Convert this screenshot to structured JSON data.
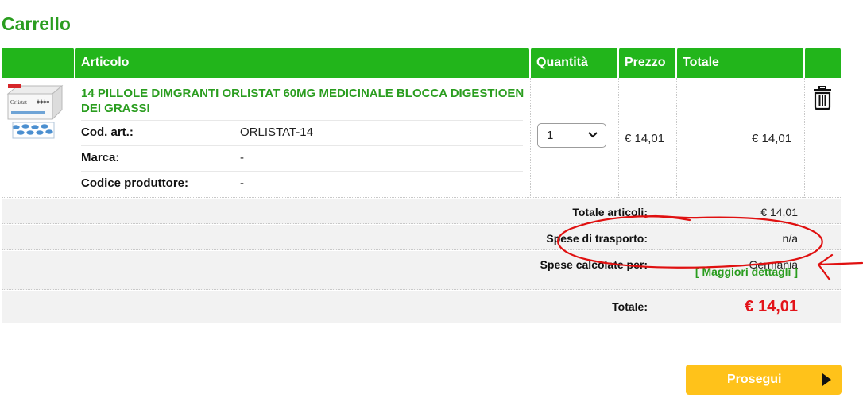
{
  "page": {
    "title": "Carrello"
  },
  "table": {
    "headers": {
      "item": "Articolo",
      "quantity": "Quantità",
      "price": "Prezzo",
      "total": "Totale"
    }
  },
  "product": {
    "name": "14 PILLOLE DIMGRANTI ORLISTAT 60MG MEDICINALE BLOCCA DIGESTIOEN DEI GRASSI",
    "image_label": "Orlistat",
    "attributes": [
      {
        "label": "Cod. art.:",
        "value": "ORLISTAT-14"
      },
      {
        "label": "Marca:",
        "value": "-"
      },
      {
        "label": "Codice produttore:",
        "value": "-"
      }
    ],
    "quantity": "1",
    "unit_price": "€ 14,01",
    "line_total": "€ 14,01",
    "delete_icon": "trash-icon"
  },
  "summary": {
    "items_total_label": "Totale articoli:",
    "items_total_value": "€ 14,01",
    "shipping_label": "Spese di trasporto:",
    "shipping_value": "n/a",
    "calc_for_label": "Spese calcolate per:",
    "calc_for_value": "Germania",
    "details_link": "[ Maggiori dettagli ]",
    "grand_total_label": "Totale:",
    "grand_total_value": "€ 14,01"
  },
  "actions": {
    "proceed_label": "Prosegui"
  },
  "colors": {
    "accent_green": "#22b51b",
    "link_green": "#2a9d1f",
    "total_red": "#e3141a",
    "button_yellow": "#ffc21a",
    "annotation_red": "#e01010"
  }
}
